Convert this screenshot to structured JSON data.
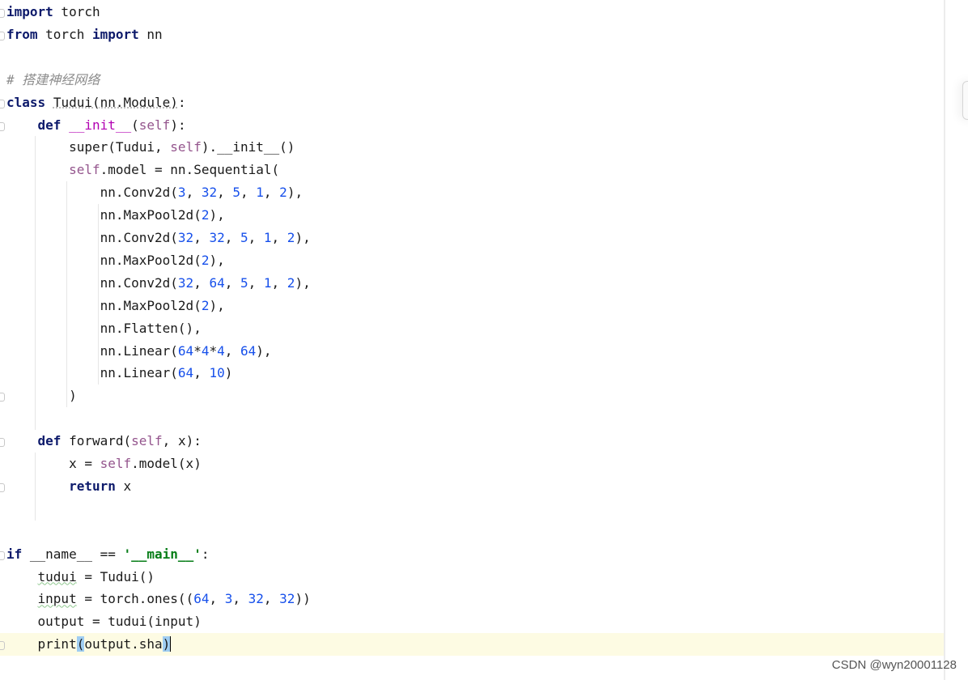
{
  "editor": {
    "current_line": 28,
    "lines": [
      [
        [
          "k",
          "import"
        ],
        [
          "p",
          " torch"
        ]
      ],
      [
        [
          "k",
          "from"
        ],
        [
          "p",
          " torch "
        ],
        [
          "k",
          "import"
        ],
        [
          "p",
          " nn"
        ]
      ],
      [],
      [
        [
          "c",
          "# 搭建神经网络"
        ]
      ],
      [
        [
          "k",
          "class"
        ],
        [
          "p",
          " "
        ],
        [
          "uw",
          "Tudui(nn.Module)"
        ],
        [
          "p",
          ":"
        ]
      ],
      [
        [
          "p",
          "    "
        ],
        [
          "k",
          "def"
        ],
        [
          "p",
          " "
        ],
        [
          "d",
          "__init__"
        ],
        [
          "p",
          "("
        ],
        [
          "s",
          "self"
        ],
        [
          "p",
          "):"
        ]
      ],
      [
        [
          "p",
          "        super(Tudui, "
        ],
        [
          "s",
          "self"
        ],
        [
          "p",
          ").__init__()"
        ]
      ],
      [
        [
          "p",
          "        "
        ],
        [
          "s",
          "self"
        ],
        [
          "p",
          ".model = nn.Sequential("
        ]
      ],
      [
        [
          "p",
          "            nn.Conv2d("
        ],
        [
          "n",
          "3"
        ],
        [
          "p",
          ", "
        ],
        [
          "n",
          "32"
        ],
        [
          "p",
          ", "
        ],
        [
          "n",
          "5"
        ],
        [
          "p",
          ", "
        ],
        [
          "n",
          "1"
        ],
        [
          "p",
          ", "
        ],
        [
          "n",
          "2"
        ],
        [
          "p",
          "),"
        ]
      ],
      [
        [
          "p",
          "            nn.MaxPool2d("
        ],
        [
          "n",
          "2"
        ],
        [
          "p",
          "),"
        ]
      ],
      [
        [
          "p",
          "            nn.Conv2d("
        ],
        [
          "n",
          "32"
        ],
        [
          "p",
          ", "
        ],
        [
          "n",
          "32"
        ],
        [
          "p",
          ", "
        ],
        [
          "n",
          "5"
        ],
        [
          "p",
          ", "
        ],
        [
          "n",
          "1"
        ],
        [
          "p",
          ", "
        ],
        [
          "n",
          "2"
        ],
        [
          "p",
          "),"
        ]
      ],
      [
        [
          "p",
          "            nn.MaxPool2d("
        ],
        [
          "n",
          "2"
        ],
        [
          "p",
          "),"
        ]
      ],
      [
        [
          "p",
          "            nn.Conv2d("
        ],
        [
          "n",
          "32"
        ],
        [
          "p",
          ", "
        ],
        [
          "n",
          "64"
        ],
        [
          "p",
          ", "
        ],
        [
          "n",
          "5"
        ],
        [
          "p",
          ", "
        ],
        [
          "n",
          "1"
        ],
        [
          "p",
          ", "
        ],
        [
          "n",
          "2"
        ],
        [
          "p",
          "),"
        ]
      ],
      [
        [
          "p",
          "            nn.MaxPool2d("
        ],
        [
          "n",
          "2"
        ],
        [
          "p",
          "),"
        ]
      ],
      [
        [
          "p",
          "            nn.Flatten(),"
        ]
      ],
      [
        [
          "p",
          "            nn.Linear("
        ],
        [
          "n",
          "64"
        ],
        [
          "p",
          "*"
        ],
        [
          "n",
          "4"
        ],
        [
          "p",
          "*"
        ],
        [
          "n",
          "4"
        ],
        [
          "p",
          ", "
        ],
        [
          "n",
          "64"
        ],
        [
          "p",
          "),"
        ]
      ],
      [
        [
          "p",
          "            nn.Linear("
        ],
        [
          "n",
          "64"
        ],
        [
          "p",
          ", "
        ],
        [
          "n",
          "10"
        ],
        [
          "p",
          ")"
        ]
      ],
      [
        [
          "p",
          "        )"
        ]
      ],
      [],
      [
        [
          "p",
          "    "
        ],
        [
          "k",
          "def"
        ],
        [
          "p",
          " forward("
        ],
        [
          "s",
          "self"
        ],
        [
          "p",
          ", x):"
        ]
      ],
      [
        [
          "p",
          "        x = "
        ],
        [
          "s",
          "self"
        ],
        [
          "p",
          ".model(x)"
        ]
      ],
      [
        [
          "p",
          "        "
        ],
        [
          "k",
          "return"
        ],
        [
          "p",
          " x"
        ]
      ],
      [],
      [],
      [
        [
          "k",
          "if"
        ],
        [
          "p",
          " __name__ == "
        ],
        [
          "st",
          "'__main__'"
        ],
        [
          "p",
          ":"
        ]
      ],
      [
        [
          "p",
          "    "
        ],
        [
          "u",
          "tudui"
        ],
        [
          "p",
          " = Tudui()"
        ]
      ],
      [
        [
          "p",
          "    "
        ],
        [
          "u",
          "input"
        ],
        [
          "p",
          " = torch.ones(("
        ],
        [
          "n",
          "64"
        ],
        [
          "p",
          ", "
        ],
        [
          "n",
          "3"
        ],
        [
          "p",
          ", "
        ],
        [
          "n",
          "32"
        ],
        [
          "p",
          ", "
        ],
        [
          "n",
          "32"
        ],
        [
          "p",
          "))"
        ]
      ],
      [
        [
          "p",
          "    output = tudui(input)"
        ]
      ],
      [
        [
          "p",
          "    print"
        ],
        [
          "br",
          "("
        ],
        [
          "p",
          "output.sha"
        ],
        [
          "br caret",
          ")"
        ]
      ]
    ]
  },
  "watermark": "CSDN @wyn20001128"
}
